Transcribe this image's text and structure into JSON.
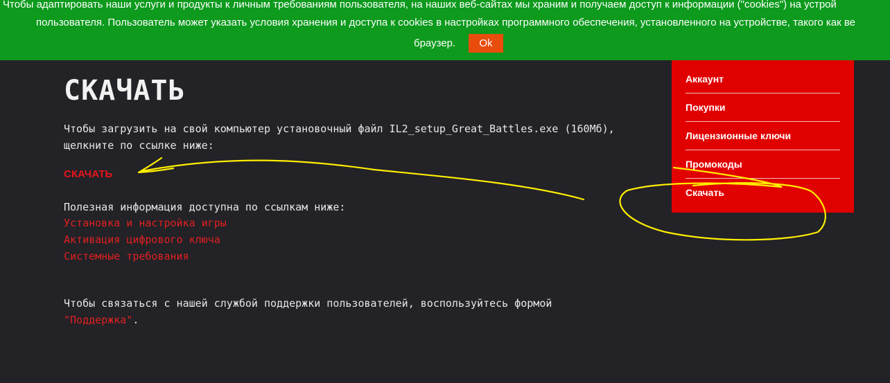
{
  "cookie_banner": {
    "line1": "Чтобы адаптировать наши услуги и продукты к личным требованиям пользователя, на наших веб-сайтах мы храним и получаем доступ к информации (\"cookies\") на устрой",
    "line2": "пользователя. Пользователь может указать условия хранения и доступа к cookies в настройках программного обеспечения, установленного на устройстве, такого как ве",
    "line3": "браузер.",
    "ok_label": "Ok"
  },
  "main": {
    "title": "СКАЧАТЬ",
    "intro": "Чтобы загрузить на свой компьютер установочный файл IL2_setup_Great_Battles.exe (160Мб), щелкните по ссылке ниже:",
    "download_link": "СКАЧАТЬ",
    "useful_info": "Полезная информация доступна по ссылкам ниже:",
    "links": [
      "Установка и настройка игры",
      "Активация цифрового ключа",
      "Системные требования"
    ],
    "support_text": "Чтобы связаться с нашей службой поддержки пользователей, воспользуйтесь формой ",
    "support_link": "\"Поддержка\"",
    "support_end": "."
  },
  "side_menu": {
    "items": [
      "Аккаунт",
      "Покупки",
      "Лицензионные ключи",
      "Промокоды",
      "Скачать"
    ]
  },
  "colors": {
    "banner": "#0d9a1d",
    "ok_button": "#e84d0e",
    "accent_red": "#e10000",
    "background": "#222227",
    "annotation": "#ffee00"
  }
}
